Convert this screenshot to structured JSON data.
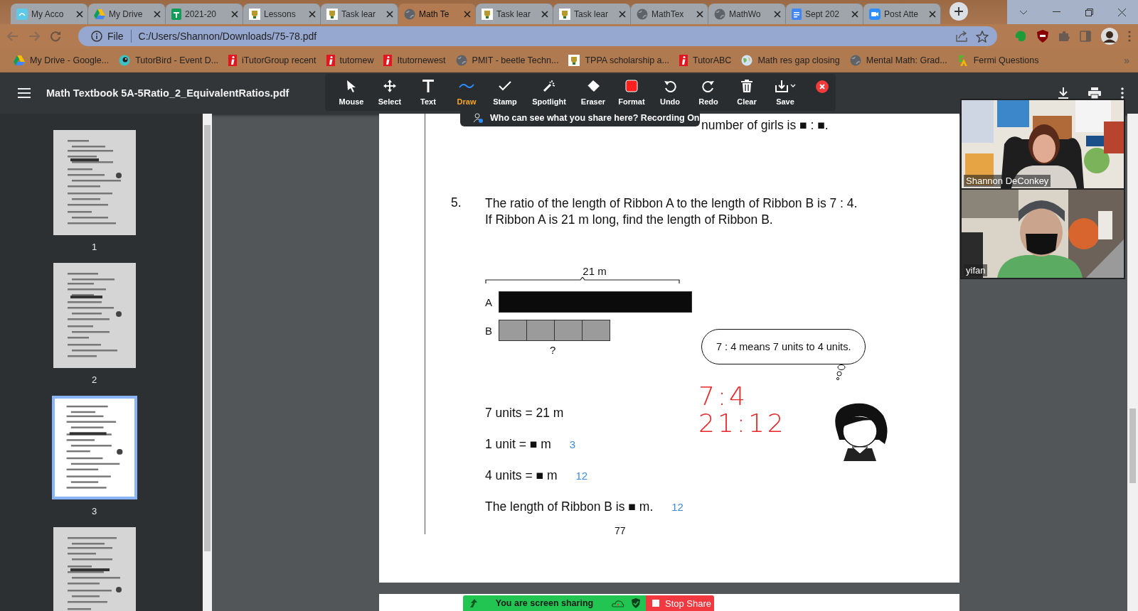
{
  "browser": {
    "tabs": [
      {
        "title": "My Acco",
        "kind": "app",
        "selected": false
      },
      {
        "title": "My Drive",
        "kind": "drive",
        "selected": false
      },
      {
        "title": "2021-20",
        "kind": "sheets",
        "selected": false
      },
      {
        "title": "Lessons",
        "kind": "crest",
        "selected": false
      },
      {
        "title": "Task lear",
        "kind": "crest",
        "selected": false
      },
      {
        "title": "Math Te",
        "kind": "globe",
        "selected": true
      },
      {
        "title": "Task lear",
        "kind": "crest",
        "selected": false
      },
      {
        "title": "Task lear",
        "kind": "crest",
        "selected": false
      },
      {
        "title": "MathTex",
        "kind": "globe",
        "selected": false
      },
      {
        "title": "MathWo",
        "kind": "globe",
        "selected": false
      },
      {
        "title": "Sept 202",
        "kind": "docs",
        "selected": false
      },
      {
        "title": "Post Atte",
        "kind": "video",
        "selected": false
      }
    ],
    "address": {
      "scheme": "File",
      "url": "C:/Users/Shannon/Downloads/75-78.pdf"
    },
    "bookmarks": [
      {
        "label": "My Drive - Google...",
        "kind": "drive"
      },
      {
        "label": "TutorBird - Event D...",
        "kind": "bird"
      },
      {
        "label": "iTutorGroup recent",
        "kind": "red"
      },
      {
        "label": "tutornew",
        "kind": "red"
      },
      {
        "label": "Itutornewest",
        "kind": "red"
      },
      {
        "label": "PMIT - beetle Techn...",
        "kind": "globe"
      },
      {
        "label": "TPPA scholarship a...",
        "kind": "crest"
      },
      {
        "label": "TutorABC",
        "kind": "red"
      },
      {
        "label": "Math res gap closing",
        "kind": "earth"
      },
      {
        "label": "Mental Math: Grad...",
        "kind": "globe"
      },
      {
        "label": "Fermi Questions",
        "kind": "fermi"
      }
    ],
    "more": "»"
  },
  "pdf_viewer": {
    "file_name": "Math Textbook 5A-5Ratio_2_EquivalentRatios.pdf",
    "thumbnails": [
      {
        "page": "1",
        "selected": false
      },
      {
        "page": "2",
        "selected": false
      },
      {
        "page": "3",
        "selected": true
      },
      {
        "selected": false
      }
    ]
  },
  "annotation_toolbar": {
    "tools": [
      {
        "label": "Mouse",
        "kind": "mouse",
        "selected": false
      },
      {
        "label": "Select",
        "kind": "select",
        "selected": false
      },
      {
        "label": "Text",
        "kind": "text",
        "selected": false
      },
      {
        "label": "Draw",
        "kind": "draw",
        "selected": true
      },
      {
        "label": "Stamp",
        "kind": "stamp",
        "selected": false
      },
      {
        "label": "Spotlight",
        "kind": "spotlight",
        "selected": false
      },
      {
        "label": "Eraser",
        "kind": "eraser",
        "selected": false
      },
      {
        "label": "Format",
        "kind": "format",
        "selected": false
      },
      {
        "label": "Undo",
        "kind": "undo",
        "selected": false
      },
      {
        "label": "Redo",
        "kind": "redo",
        "selected": false
      },
      {
        "label": "Clear",
        "kind": "clear",
        "selected": false
      },
      {
        "label": "Save",
        "kind": "save",
        "selected": false
      },
      {
        "kind": "close",
        "selected": false
      }
    ]
  },
  "share_notice": "Who can see what you share here? Recording On",
  "document": {
    "previous_sentence": "number of girls is ■ : ■.",
    "question": {
      "number": "5.",
      "lines": [
        "The ratio of the length of Ribbon A to the length of Ribbon B is 7 : 4.",
        "If Ribbon A is 21 m long, find the length of Ribbon B."
      ]
    },
    "diagram": {
      "total": "21 m",
      "bars": [
        {
          "label": "A",
          "kind": "solid"
        },
        {
          "label": "B",
          "kind": "units"
        }
      ],
      "unknown": "?"
    },
    "bubble": "7 : 4 means 7 units to 4 units.",
    "handwriting": [
      "7:4",
      "21:12"
    ],
    "steps": [
      {
        "text": "7 units = 21 m"
      },
      {
        "text": "1 unit = ■ m",
        "answer": "3"
      },
      {
        "text": "4 units = ■ m",
        "answer": "12"
      },
      {
        "text": "The length of Ribbon B is ■ m.",
        "answer": "12"
      }
    ],
    "page_number": "77"
  },
  "participants": [
    {
      "name": "Shannon DeConkey"
    },
    {
      "name": "yifan"
    }
  ],
  "sharing_bar": {
    "status": "You are screen sharing",
    "stop": "Stop Share"
  }
}
